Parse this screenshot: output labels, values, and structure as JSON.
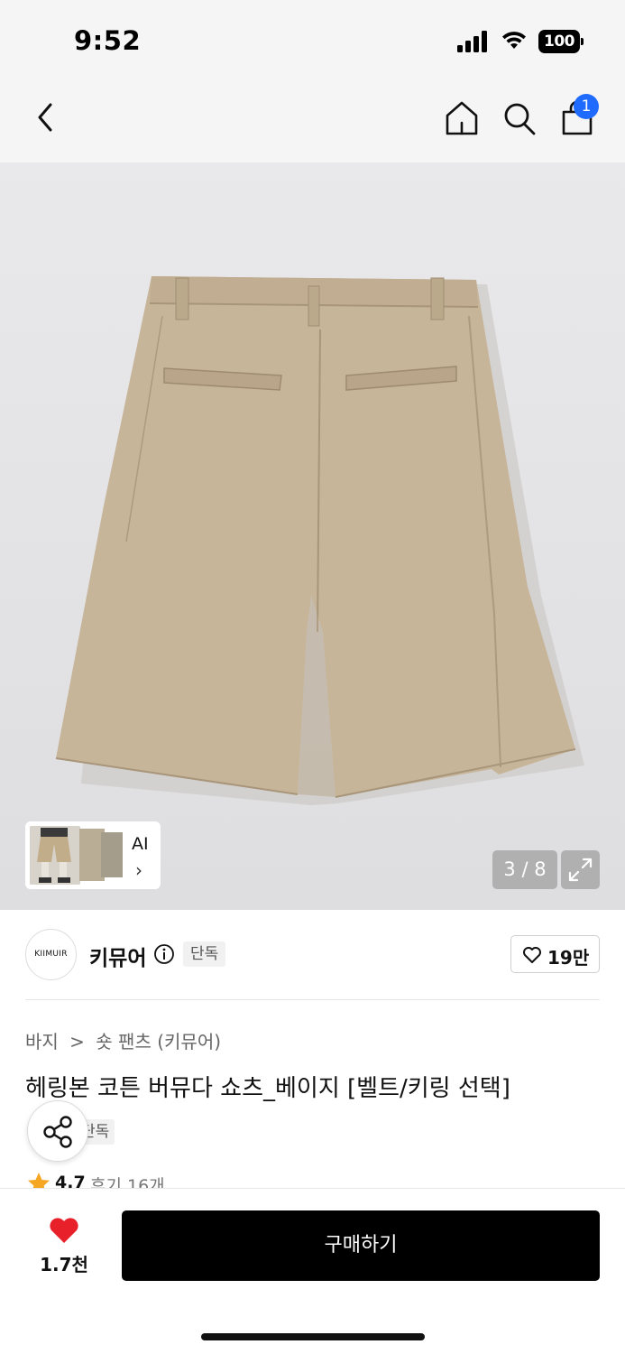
{
  "status_bar": {
    "time": "9:52",
    "battery": "100",
    "icons": [
      "signal-icon",
      "wifi-icon",
      "battery-icon"
    ]
  },
  "nav": {
    "icons": [
      "back-icon",
      "home-icon",
      "search-icon",
      "shopping-bag-icon"
    ],
    "bag_badge": "1"
  },
  "gallery": {
    "ai_label": "AI",
    "ai_chevron": "›",
    "page_counter": "3 / 8",
    "expand_icon": "expand-icon",
    "image_description_icon": "shorts-image"
  },
  "brand": {
    "logo_text": "KIIMUIR",
    "name": "키뮤어",
    "info_icon": "info-icon",
    "tag": "단독",
    "like_count": "19만"
  },
  "product": {
    "breadcrumb": [
      "바지",
      ">",
      "숏 팬츠 (키뮤어)"
    ],
    "title": "헤링본 코튼 버뮤다 쇼츠_베이지 [벨트/키링 선택]",
    "exclusive_tag": "단독",
    "rating": "4.7",
    "reviews": "후기 16개"
  },
  "bottom_bar": {
    "like_count": "1.7천",
    "buy_label": "구매하기"
  },
  "colors": {
    "accent_blue": "#1f6bff",
    "heart_red": "#e8202a",
    "star_orange": "#f5a623",
    "buy_black": "#000000"
  }
}
